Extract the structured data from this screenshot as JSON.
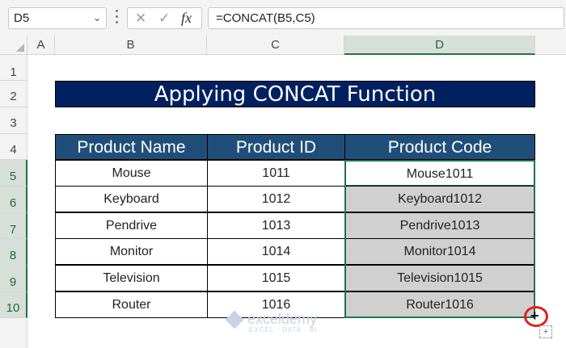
{
  "formula_bar": {
    "name_box": "D5",
    "cancel_icon": "✕",
    "enter_icon": "✓",
    "fx_label": "fx",
    "formula": "=CONCAT(B5,C5)"
  },
  "columns": [
    "A",
    "B",
    "C",
    "D"
  ],
  "rows": [
    "1",
    "2",
    "3",
    "4",
    "5",
    "6",
    "7",
    "8",
    "9",
    "10"
  ],
  "title": "Applying CONCAT Function",
  "table": {
    "headers": [
      "Product Name",
      "Product ID",
      "Product Code"
    ],
    "rows": [
      {
        "name": "Mouse",
        "id": "1011",
        "code": "Mouse1011"
      },
      {
        "name": "Keyboard",
        "id": "1012",
        "code": "Keyboard1012"
      },
      {
        "name": "Pendrive",
        "id": "1013",
        "code": "Pendrive1013"
      },
      {
        "name": "Monitor",
        "id": "1014",
        "code": "Monitor1014"
      },
      {
        "name": "Television",
        "id": "1015",
        "code": "Television1015"
      },
      {
        "name": "Router",
        "id": "1016",
        "code": "Router1016"
      }
    ]
  },
  "watermark": {
    "brand": "exceldemy",
    "tagline": "EXCEL · DATA · BI"
  },
  "colors": {
    "title_bg": "#002060",
    "header_bg": "#1f4e79",
    "selection": "#217346",
    "fill_circle": "#e02020"
  }
}
